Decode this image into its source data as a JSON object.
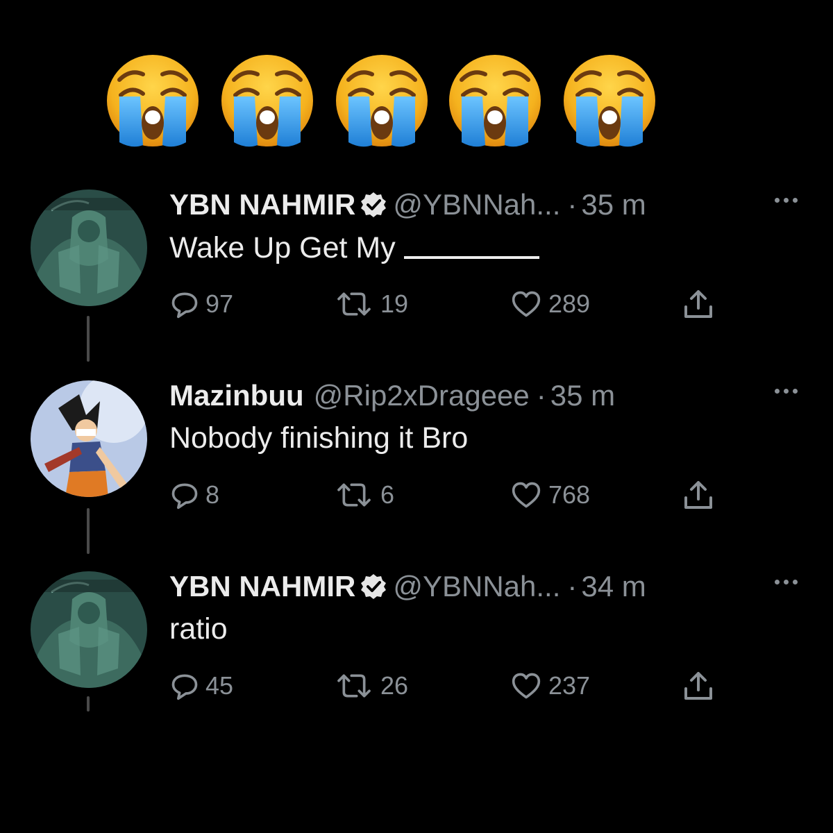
{
  "emojis": [
    {
      "icon": "loudly-crying-face-icon"
    },
    {
      "icon": "loudly-crying-face-icon"
    },
    {
      "icon": "loudly-crying-face-icon"
    },
    {
      "icon": "loudly-crying-face-icon"
    },
    {
      "icon": "loudly-crying-face-icon"
    }
  ],
  "colors": {
    "background": "#000000",
    "text": "#ececec",
    "muted": "#8b9197",
    "emoji_face": "#f5b21e",
    "emoji_tears": "#3aa0e8"
  },
  "tweets": [
    {
      "name": "YBN NAHMIR",
      "verified": true,
      "handle": "@YBNNah...",
      "separator": "·",
      "time": "35 m",
      "text": "Wake Up Get My",
      "blank_line": true,
      "avatar_icon": "visionland-avatar-icon",
      "replies": "97",
      "retweets": "19",
      "likes": "289"
    },
    {
      "name": "Mazinbuu",
      "verified": false,
      "handle": "@Rip2xDrageee",
      "separator": "·",
      "time": "35 m",
      "text": "Nobody finishing it Bro",
      "blank_line": false,
      "avatar_icon": "anime-character-avatar-icon",
      "replies": "8",
      "retweets": "6",
      "likes": "768"
    },
    {
      "name": "YBN NAHMIR",
      "verified": true,
      "handle": "@YBNNah...",
      "separator": "·",
      "time": "34 m",
      "text": "ratio",
      "blank_line": false,
      "avatar_icon": "visionland-avatar-icon",
      "replies": "45",
      "retweets": "26",
      "likes": "237"
    }
  ]
}
